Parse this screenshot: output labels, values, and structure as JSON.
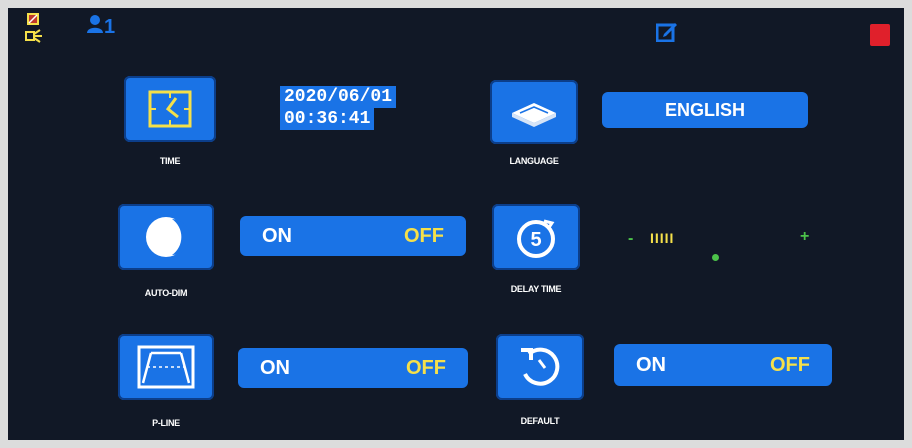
{
  "status_bar": {
    "user_count": "1",
    "icons": [
      "sd-card-icon",
      "signal-icon",
      "user-icon",
      "edit-icon",
      "record-icon"
    ]
  },
  "settings": {
    "time": {
      "label": "TIME",
      "date": "2020/06/01",
      "clock": "00:36:41"
    },
    "language": {
      "label": "LANGUAGE",
      "value": "ENGLISH"
    },
    "auto_dim": {
      "label": "AUTO-DIM",
      "on": "ON",
      "off": "OFF"
    },
    "delay_time": {
      "label": "DELAY TIME",
      "icon_digit": "5",
      "level_text": "IIIII",
      "minus": "-",
      "plus": "+"
    },
    "p_line": {
      "label": "P-LINE",
      "on": "ON",
      "off": "OFF"
    },
    "default": {
      "label": "DEFAULT",
      "on": "ON",
      "off": "OFF"
    }
  },
  "colors": {
    "background": "#111826",
    "tile": "#1a73e6",
    "off_text": "#f5e04a",
    "slider_green": "#4cc24a"
  }
}
